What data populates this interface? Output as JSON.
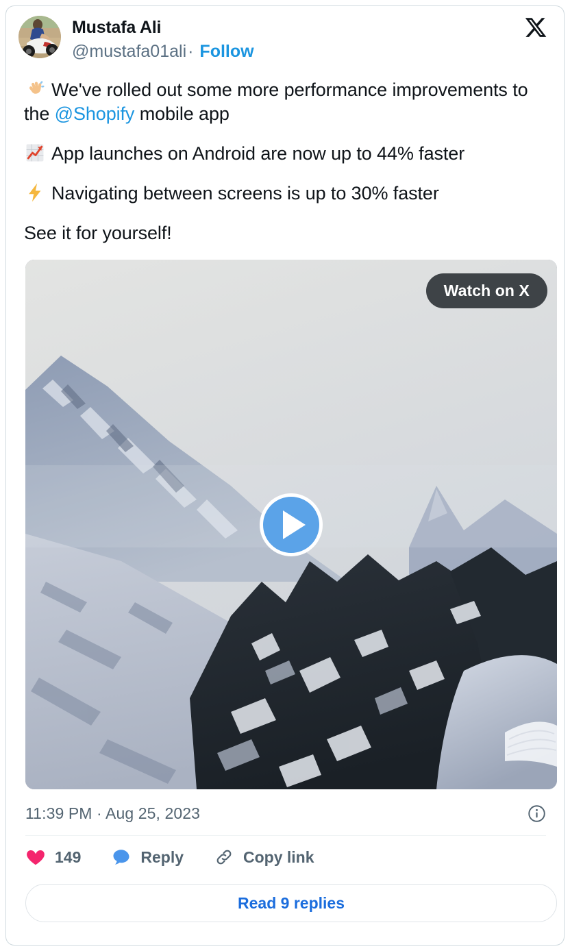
{
  "card": {
    "border_color": "#cfd9de"
  },
  "header": {
    "author_name": "Mustafa Ali",
    "handle": "@mustafa01ali",
    "separator": "·",
    "follow_label": "Follow",
    "avatar_alt": "avatar",
    "brand_icon": "x-logo-icon"
  },
  "tweet": {
    "lines": [
      {
        "emoji": "waving-hand-emoji",
        "parts": [
          {
            "type": "text",
            "text": "We've rolled out some more performance improvements to the "
          },
          {
            "type": "mention",
            "text": "@Shopify"
          },
          {
            "type": "text",
            "text": " mobile app"
          }
        ]
      },
      {
        "emoji": "chart-increasing-emoji",
        "parts": [
          {
            "type": "text",
            "text": "App launches on Android are now up to 44% faster"
          }
        ]
      },
      {
        "emoji": "high-voltage-emoji",
        "parts": [
          {
            "type": "text",
            "text": "Navigating between screens is up to 30% faster"
          }
        ]
      },
      {
        "emoji": null,
        "parts": [
          {
            "type": "text",
            "text": "See it for yourself!"
          }
        ]
      }
    ]
  },
  "video": {
    "watch_label": "Watch on X",
    "play_icon": "play-icon",
    "thumbnail_alt": "snowy mountain landscape"
  },
  "meta": {
    "timestamp": "11:39 PM · Aug 25, 2023",
    "info_icon": "info-icon"
  },
  "actions": [
    {
      "icon": "heart-icon",
      "label": "149",
      "color": "#f4256d"
    },
    {
      "icon": "reply-bubble-icon",
      "label": "Reply",
      "color": "#4a95eb"
    },
    {
      "icon": "link-icon",
      "label": "Copy link",
      "color": "#536471"
    }
  ],
  "footer": {
    "read_replies_label": "Read 9 replies",
    "link_color": "#1b6ddd"
  },
  "colors": {
    "accent_blue": "#1b95e0",
    "heart_pink": "#f4256d",
    "reply_blue": "#4a95eb",
    "text_primary": "#0f1419",
    "text_secondary": "#536471",
    "play_blue": "#5ba3e8",
    "watch_btn_bg": "#3e4347"
  }
}
